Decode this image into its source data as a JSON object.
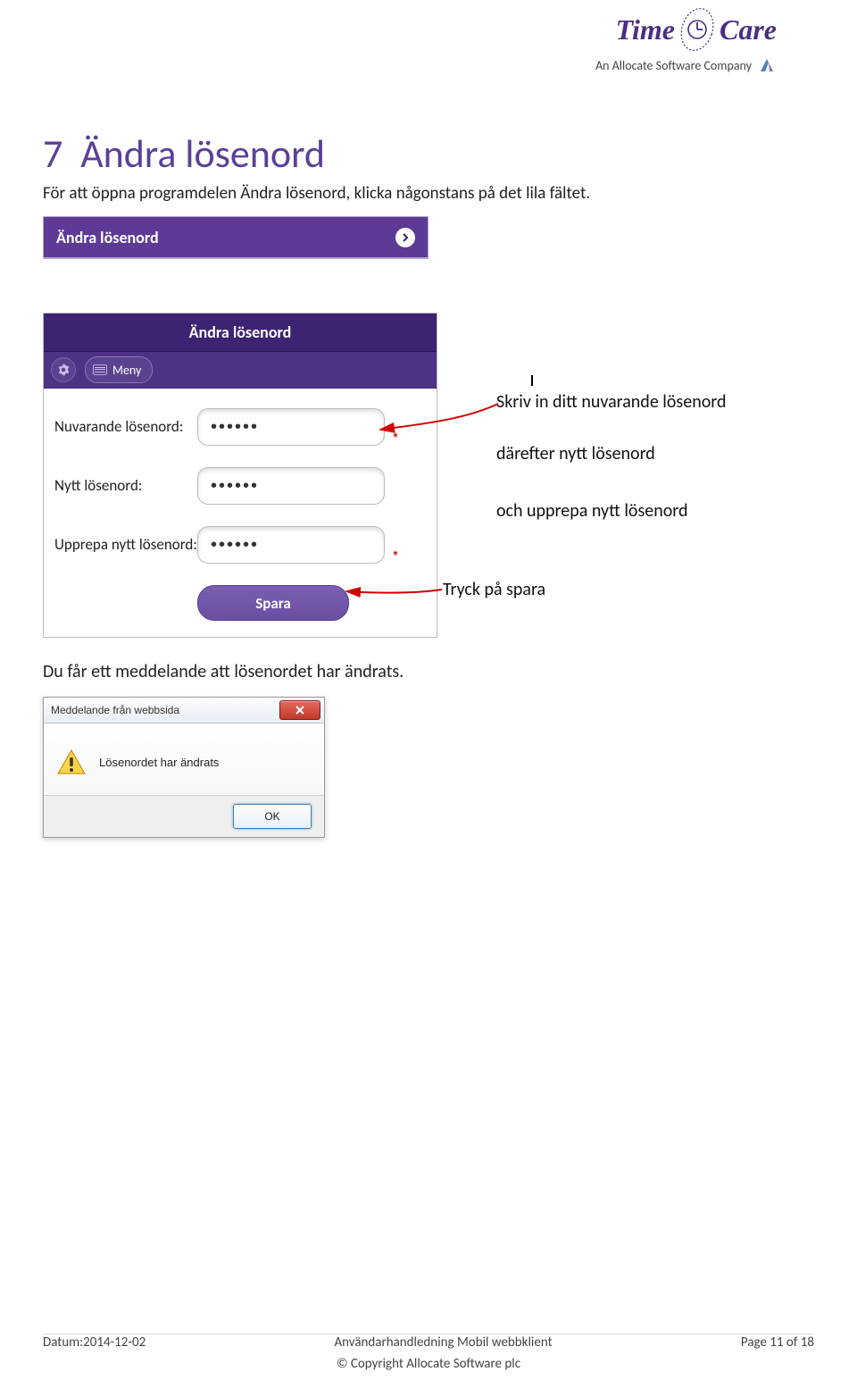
{
  "logo": {
    "brand_left": "Time",
    "brand_right": "Care",
    "subtitle": "An Allocate Software Company"
  },
  "heading": {
    "number": "7",
    "title": "Ändra lösenord"
  },
  "intro": "För att öppna programdelen Ändra lösenord, klicka någonstans på det lila fältet.",
  "bar": {
    "label": "Ändra lösenord"
  },
  "app": {
    "header": "Ändra lösenord",
    "menu_label": "Meny",
    "fields": {
      "current_label": "Nuvarande lösenord:",
      "current_value": "••••••",
      "new_label": "Nytt lösenord:",
      "new_value": "••••••",
      "repeat_label": "Upprepa nytt lösenord:",
      "repeat_value": "••••••",
      "required_mark": "*"
    },
    "save_label": "Spara"
  },
  "annotations": {
    "a1": "Skriv in ditt nuvarande lösenord",
    "a2": "därefter nytt lösenord",
    "a3": "och upprepa nytt lösenord",
    "a4": "Tryck på spara"
  },
  "message_intro": "Du får ett meddelande att lösenordet har ändrats.",
  "dialog": {
    "title": "Meddelande från webbsida",
    "body": "Lösenordet har ändrats",
    "ok": "OK"
  },
  "footer": {
    "date": "Datum:2014-12-02",
    "doc": "Användarhandledning Mobil webbklient",
    "page": "Page 11 of 18",
    "copyright": "© Copyright Allocate Software plc"
  }
}
